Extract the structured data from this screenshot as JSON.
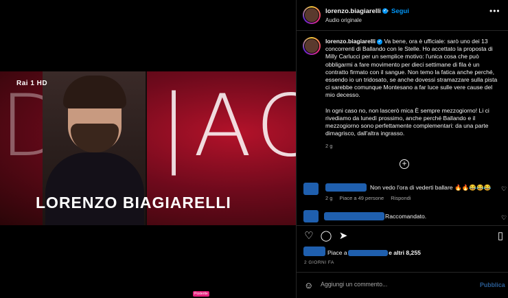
{
  "media": {
    "channel_logo": "Rai 1 HD",
    "decor_left": "D",
    "decor_right": "|AC",
    "caption_text": "LORENZO BIAGIARELLI",
    "mute_icon": "speaker-muted-icon"
  },
  "header": {
    "username": "lorenzo.biagiarelli",
    "separator": "•",
    "follow_label": "Segui",
    "audio": "Audio originale",
    "more": "•••"
  },
  "post": {
    "username": "lorenzo.biagiarelli",
    "paragraph1": "Va bene, ora è ufficiale: sarò uno dei 13 concorrenti di Ballando con le Stelle. Ho accettato la proposta di Milly Carlucci per un semplice motivo: l'unica cosa che può obbligarmi a fare movimento per dieci settimane di fila è un contratto firmato con il sangue. Non temo la fatica anche perché, essendo io un tridosato, se anche dovessi stramazzare sulla pista ci sarebbe comunque Montesano a far luce sulle vere cause del mio decesso.",
    "paragraph2": "In ogni caso no, non lascerò mica È sempre mezzogiorno! Li ci rivediamo da lunedì prossimo, anche perché Ballando e il mezzogiorno sono perfettamente complementari: da una parte dimagrisco, dall'altra ingrasso.",
    "time": "2 g"
  },
  "comments": [
    {
      "text": "Non vedo l'ora di vederti ballare 🔥🔥😂😂😂",
      "time": "2 g",
      "likes": "Piace a 49 persone",
      "reply": "Rispondi"
    },
    {
      "text": "Raccomandato."
    }
  ],
  "likes": {
    "prefix": "Piace a ",
    "suffix": "e altri 8,255"
  },
  "posted_ago": "2 GIORNI FA",
  "add_comment": {
    "placeholder": "Aggiungi un commento...",
    "publish": "Pubblica"
  },
  "badge": "Posterite",
  "colors": {
    "accent": "#0095f6",
    "background": "#000000",
    "redaction": "#1f5fae"
  }
}
